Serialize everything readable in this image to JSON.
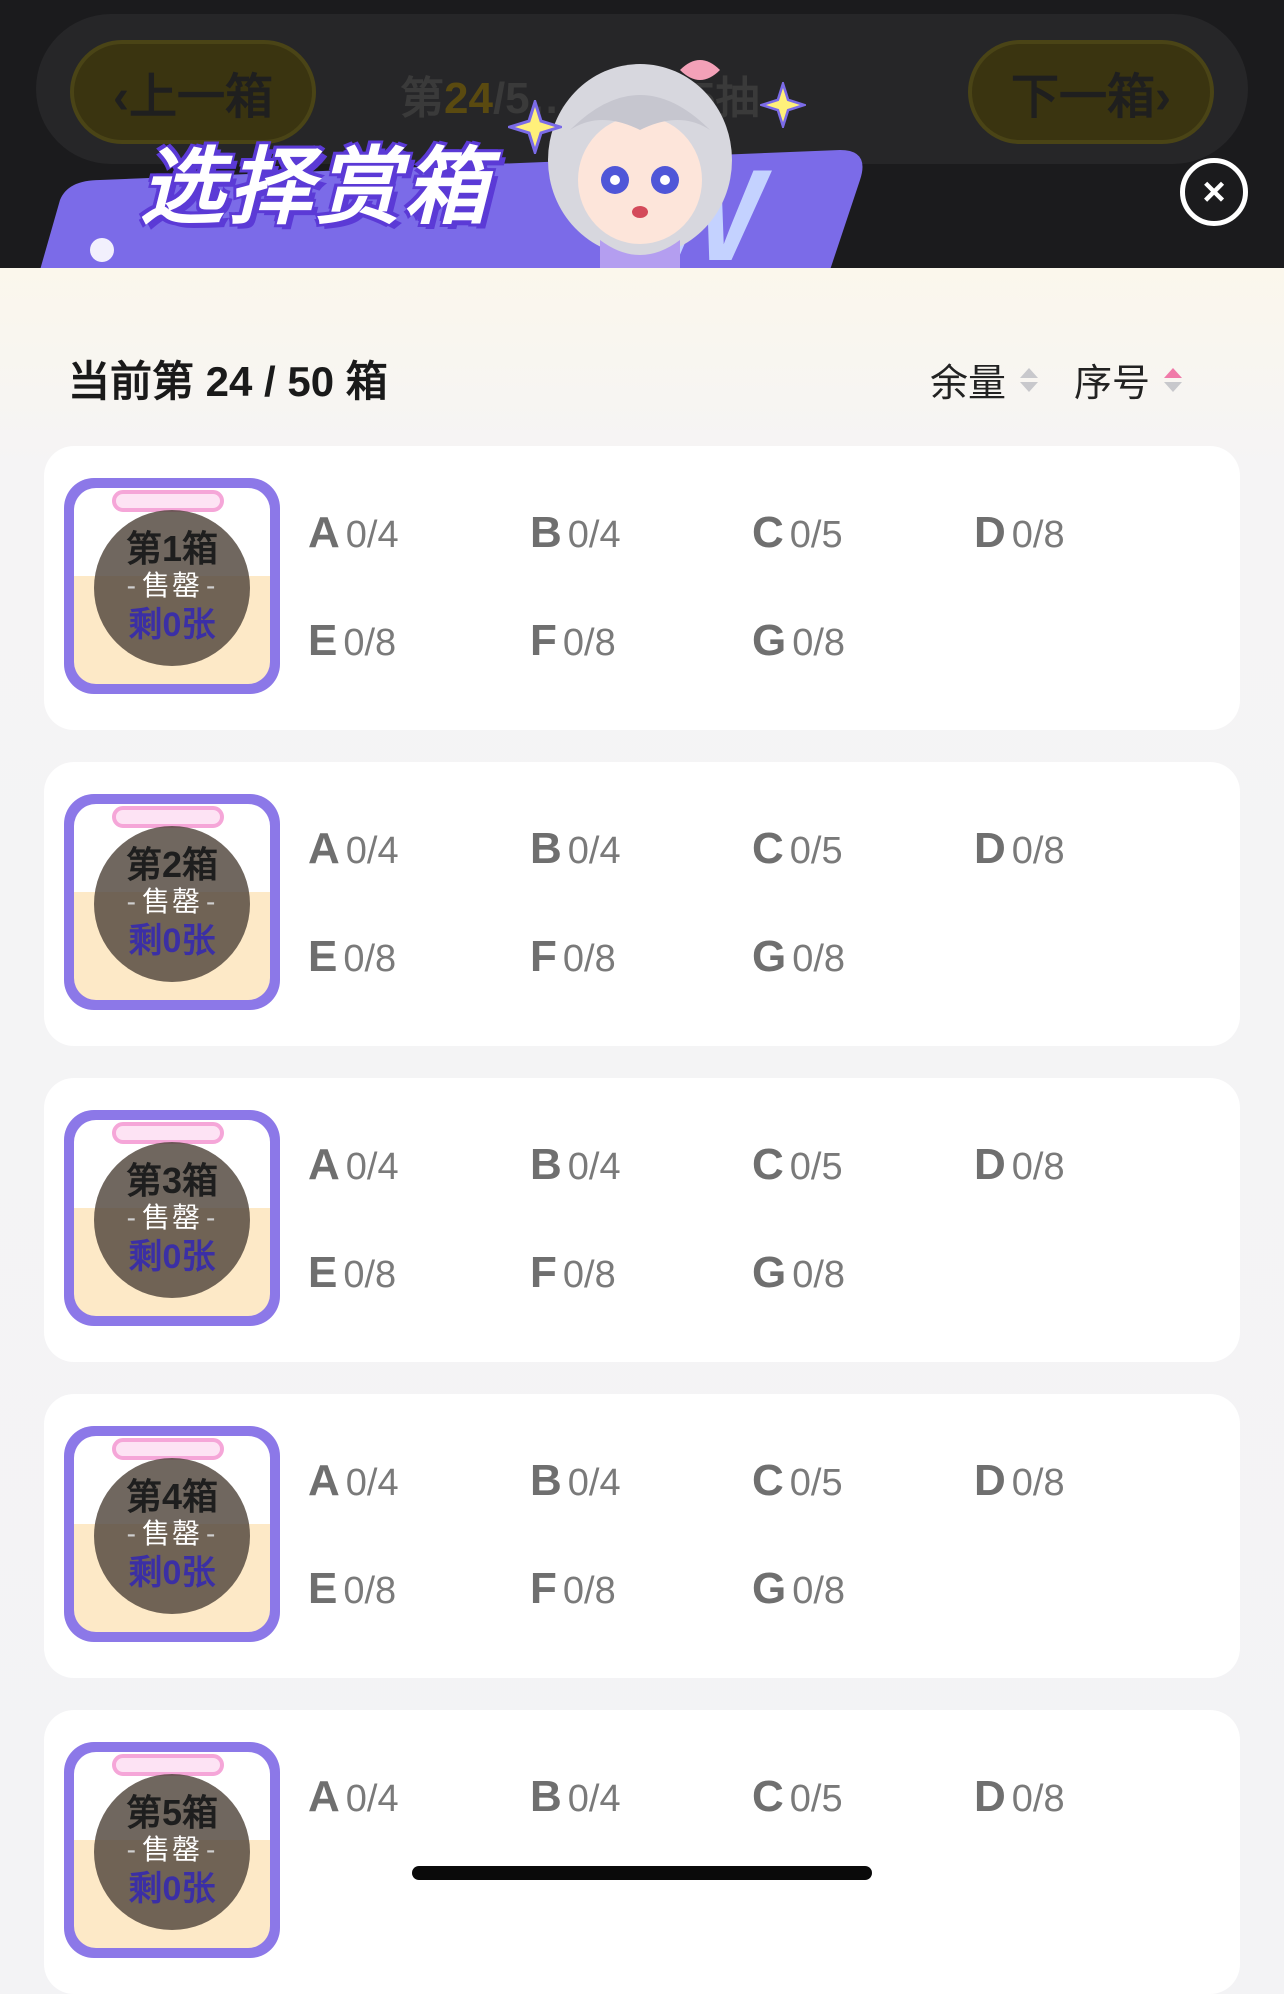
{
  "background_nav": {
    "prev_label": "‹上一箱",
    "next_label": "下一箱›",
    "info_prefix": "第",
    "info_highlight": "24",
    "info_rest": "/5… …0/45抽"
  },
  "modal": {
    "title": "选择赏箱",
    "close_label": "×",
    "current_label": "当前第 24 / 50 箱",
    "sort_amount_label": "余量",
    "sort_order_label": "序号"
  },
  "boxes": [
    {
      "name": "第1箱",
      "status": "售罄",
      "remaining": "剩0张",
      "prizes": [
        {
          "lv": "A",
          "count": "0/4"
        },
        {
          "lv": "B",
          "count": "0/4"
        },
        {
          "lv": "C",
          "count": "0/5"
        },
        {
          "lv": "D",
          "count": "0/8"
        },
        {
          "lv": "E",
          "count": "0/8"
        },
        {
          "lv": "F",
          "count": "0/8"
        },
        {
          "lv": "G",
          "count": "0/8"
        }
      ]
    },
    {
      "name": "第2箱",
      "status": "售罄",
      "remaining": "剩0张",
      "prizes": [
        {
          "lv": "A",
          "count": "0/4"
        },
        {
          "lv": "B",
          "count": "0/4"
        },
        {
          "lv": "C",
          "count": "0/5"
        },
        {
          "lv": "D",
          "count": "0/8"
        },
        {
          "lv": "E",
          "count": "0/8"
        },
        {
          "lv": "F",
          "count": "0/8"
        },
        {
          "lv": "G",
          "count": "0/8"
        }
      ]
    },
    {
      "name": "第3箱",
      "status": "售罄",
      "remaining": "剩0张",
      "prizes": [
        {
          "lv": "A",
          "count": "0/4"
        },
        {
          "lv": "B",
          "count": "0/4"
        },
        {
          "lv": "C",
          "count": "0/5"
        },
        {
          "lv": "D",
          "count": "0/8"
        },
        {
          "lv": "E",
          "count": "0/8"
        },
        {
          "lv": "F",
          "count": "0/8"
        },
        {
          "lv": "G",
          "count": "0/8"
        }
      ]
    },
    {
      "name": "第4箱",
      "status": "售罄",
      "remaining": "剩0张",
      "prizes": [
        {
          "lv": "A",
          "count": "0/4"
        },
        {
          "lv": "B",
          "count": "0/4"
        },
        {
          "lv": "C",
          "count": "0/5"
        },
        {
          "lv": "D",
          "count": "0/8"
        },
        {
          "lv": "E",
          "count": "0/8"
        },
        {
          "lv": "F",
          "count": "0/8"
        },
        {
          "lv": "G",
          "count": "0/8"
        }
      ]
    },
    {
      "name": "第5箱",
      "status": "售罄",
      "remaining": "剩0张",
      "prizes": [
        {
          "lv": "A",
          "count": "0/4"
        },
        {
          "lv": "B",
          "count": "0/4"
        },
        {
          "lv": "C",
          "count": "0/5"
        },
        {
          "lv": "D",
          "count": "0/8"
        }
      ]
    }
  ],
  "colors": {
    "accent_purple": "#8c78e8",
    "sort_active": "#f07aa9",
    "remaining_text": "#3b2fa5"
  }
}
